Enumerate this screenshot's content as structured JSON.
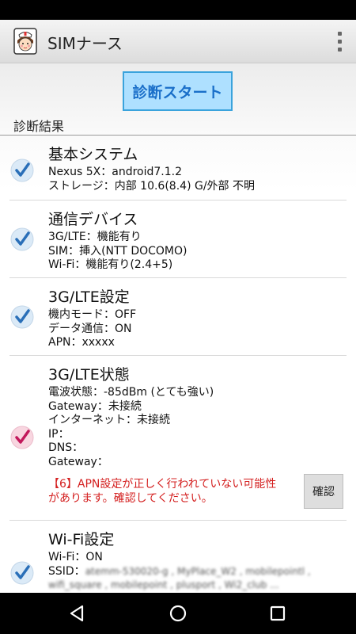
{
  "app": {
    "title": "SIMナース"
  },
  "main": {
    "start_button": "診断スタート",
    "results_heading": "診断結果"
  },
  "sections": [
    {
      "title": "基本システム",
      "status": "ok",
      "lines": [
        "Nexus 5X：android7.1.2",
        "ストレージ：内部 10.6(8.4) G/外部 不明"
      ]
    },
    {
      "title": "通信デバイス",
      "status": "ok",
      "lines": [
        "3G/LTE：機能有り",
        "SIM：挿入(NTT DOCOMO)",
        "Wi-Fi：機能有り(2.4+5)"
      ]
    },
    {
      "title": "3G/LTE設定",
      "status": "ok",
      "lines": [
        "機内モード：OFF",
        "データ通信：ON",
        "APN：xxxxx"
      ]
    },
    {
      "title": "3G/LTE状態",
      "status": "warning",
      "lines": [
        "電波状態：-85dBm (とても強い)",
        "Gateway：未接続",
        "インターネット：未接続",
        "IP：",
        "DNS：",
        "Gateway："
      ],
      "warning_lines": [
        "【6】APN設定が正しく行われていない可能性",
        "があります。確認してください。"
      ],
      "confirm_button": "確認"
    },
    {
      "title": "Wi-Fi設定",
      "status": "ok",
      "lines": [
        "Wi-Fi：ON",
        "SSID："
      ],
      "ssid_blurred": [
        "atemm-530020-g , MyPlace_W2 , mobilepointl ,",
        "wifi_square , mobilepoint , plusport , Wi2_club ..."
      ]
    }
  ],
  "colors": {
    "accent": "#1a6fc9",
    "ok_check": "#2a6fb8",
    "warn_check": "#c2185b",
    "warning_text": "#d42020"
  },
  "icons": {
    "app": "nurse-avatar-icon",
    "overflow": "more-vert-icon",
    "ok": "check-ok-icon",
    "warn": "check-warning-icon",
    "back": "back-triangle-icon",
    "home": "home-circle-icon",
    "recents": "recents-square-icon"
  }
}
